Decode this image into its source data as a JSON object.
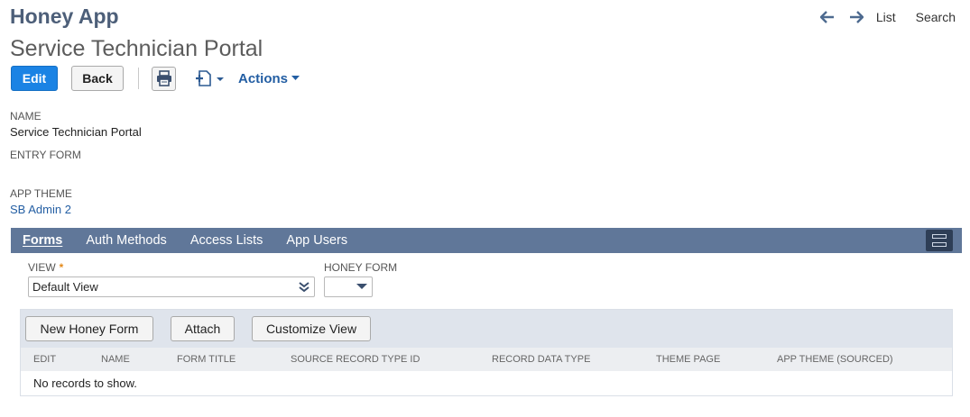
{
  "app": {
    "title": "Honey App"
  },
  "page": {
    "title": "Service Technician Portal"
  },
  "topnav": {
    "back_icon": "arrow-left-icon",
    "forward_icon": "arrow-right-icon",
    "list": "List",
    "search": "Search"
  },
  "toolbar": {
    "edit": "Edit",
    "back": "Back",
    "print_icon": "printer-icon",
    "new_record_icon": "new-record-icon",
    "actions": "Actions"
  },
  "fields": {
    "name_label": "NAME",
    "name_value": "Service Technician Portal",
    "entry_form_label": "ENTRY FORM",
    "app_theme_label": "APP THEME",
    "app_theme_value": "SB Admin 2"
  },
  "tabs": {
    "items": [
      {
        "first": "F",
        "rest": "orms"
      },
      {
        "first": "A",
        "rest": "uth Methods"
      },
      {
        "first": "A",
        "pre": "A",
        "under": "c",
        "post": "cess Lists"
      },
      {
        "first": "A",
        "rest": "pp Users"
      }
    ],
    "labels": [
      "Forms",
      "Auth Methods",
      "Access Lists",
      "App Users"
    ]
  },
  "filters": {
    "view_label": "VIEW",
    "view_required": "*",
    "view_value": "Default View",
    "honey_form_label": "HONEY FORM",
    "honey_form_value": ""
  },
  "sublist": {
    "buttons": [
      "New Honey Form",
      "Attach",
      "Customize View"
    ],
    "columns": [
      "EDIT",
      "NAME",
      "FORM TITLE",
      "SOURCE RECORD TYPE ID",
      "RECORD DATA TYPE",
      "THEME PAGE",
      "APP THEME (SOURCED)"
    ],
    "empty_text": "No records to show."
  },
  "colors": {
    "primary": "#1b83e4",
    "tabbar": "#607799",
    "link": "#235ea3",
    "required": "#e48a1b"
  }
}
